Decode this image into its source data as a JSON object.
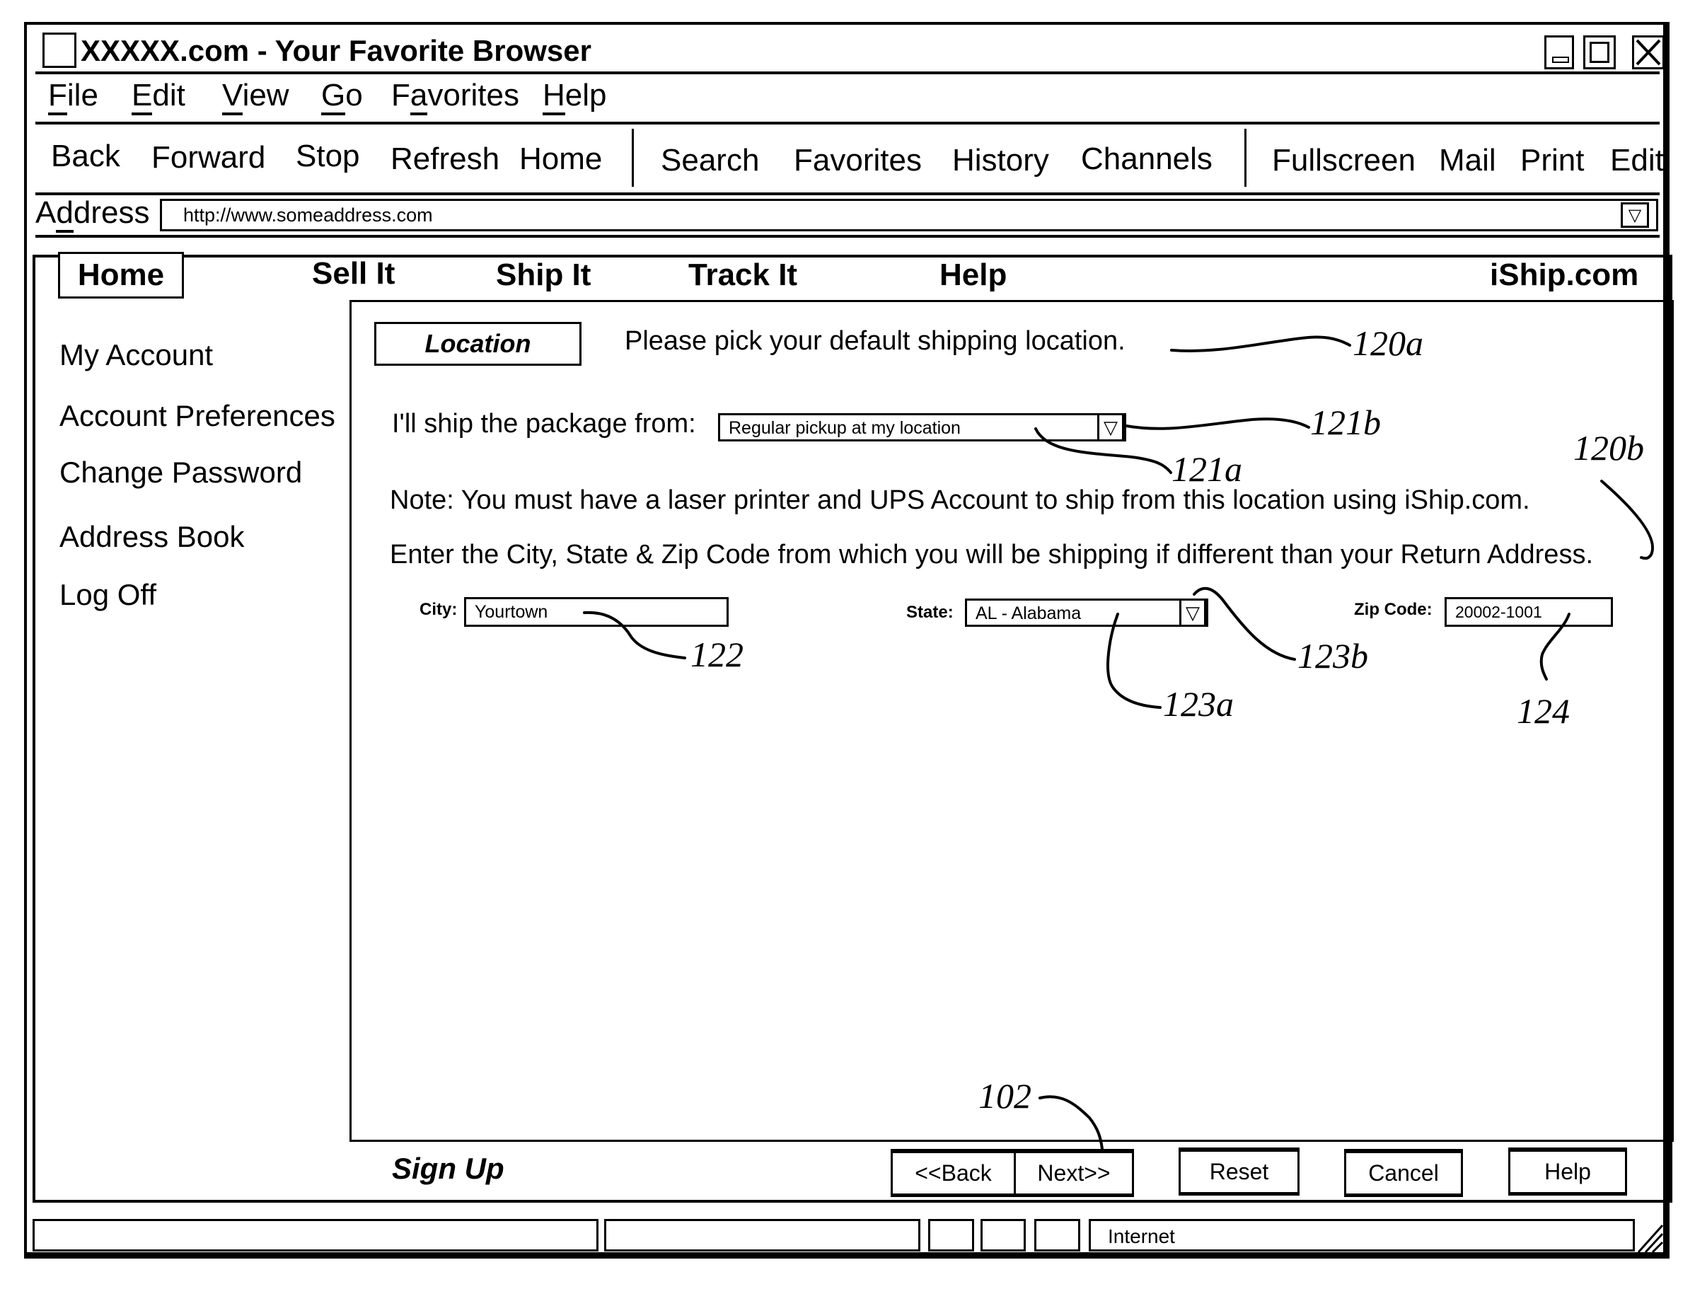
{
  "window": {
    "title": "XXXXX.com - Your Favorite Browser",
    "controls": [
      "minimize-icon",
      "maximize-icon",
      "close-icon"
    ]
  },
  "menubar": {
    "items": [
      {
        "label": "File",
        "mnemonic": "F"
      },
      {
        "label": "Edit",
        "mnemonic": "E"
      },
      {
        "label": "View",
        "mnemonic": "V"
      },
      {
        "label": "Go",
        "mnemonic": "G"
      },
      {
        "label": "Favorites",
        "mnemonic": "a"
      },
      {
        "label": "Help",
        "mnemonic": "H"
      }
    ]
  },
  "toolbar": {
    "group1": [
      "Back",
      "Forward",
      "Stop",
      "Refresh",
      "Home"
    ],
    "group2": [
      "Search",
      "Favorites",
      "History",
      "Channels"
    ],
    "group3": [
      "Fullscreen",
      "Mail",
      "Print",
      "Edit"
    ]
  },
  "address": {
    "label": "Address",
    "value": "http://www.someaddress.com"
  },
  "site_nav": {
    "items": [
      "Home",
      "Sell It",
      "Ship It",
      "Track It",
      "Help"
    ],
    "active": "Home",
    "brand": "iShip.com"
  },
  "sidebar": {
    "items": [
      "My Account",
      "Account Preferences",
      "Change Password",
      "Address Book",
      "Log Off"
    ],
    "footer": "Sign Up"
  },
  "main": {
    "section_tab": "Location",
    "prompt": "Please pick your default shipping location.",
    "ship_from_label": "I'll ship the package from:",
    "ship_from_value": "Regular pickup at my location",
    "note": "Note: You must have a laser printer and UPS Account to ship from this location using iShip.com.",
    "instruction": "Enter the City, State & Zip Code from which you will be shipping if different than your Return Address.",
    "city_label": "City:",
    "city_value": "Yourtown",
    "state_label": "State:",
    "state_value": "AL - Alabama",
    "zip_label": "Zip Code:",
    "zip_value": "20002-1001"
  },
  "buttons": {
    "back": "<<Back",
    "next": "Next>>",
    "reset": "Reset",
    "cancel": "Cancel",
    "help": "Help"
  },
  "statusbar": {
    "zone": "Internet"
  },
  "reference_numerals": {
    "r120a": "120a",
    "r120b": "120b",
    "r121a": "121a",
    "r121b": "121b",
    "r122": "122",
    "r123a": "123a",
    "r123b": "123b",
    "r124": "124",
    "r102": "102"
  }
}
